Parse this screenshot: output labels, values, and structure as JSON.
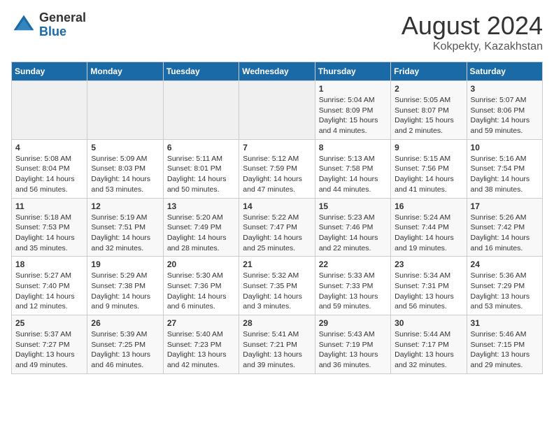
{
  "header": {
    "logo_general": "General",
    "logo_blue": "Blue",
    "title": "August 2024",
    "subtitle": "Kokpekty, Kazakhstan"
  },
  "calendar": {
    "days_of_week": [
      "Sunday",
      "Monday",
      "Tuesday",
      "Wednesday",
      "Thursday",
      "Friday",
      "Saturday"
    ],
    "weeks": [
      [
        {
          "day": "",
          "info": ""
        },
        {
          "day": "",
          "info": ""
        },
        {
          "day": "",
          "info": ""
        },
        {
          "day": "",
          "info": ""
        },
        {
          "day": "1",
          "info": "Sunrise: 5:04 AM\nSunset: 8:09 PM\nDaylight: 15 hours\nand 4 minutes."
        },
        {
          "day": "2",
          "info": "Sunrise: 5:05 AM\nSunset: 8:07 PM\nDaylight: 15 hours\nand 2 minutes."
        },
        {
          "day": "3",
          "info": "Sunrise: 5:07 AM\nSunset: 8:06 PM\nDaylight: 14 hours\nand 59 minutes."
        }
      ],
      [
        {
          "day": "4",
          "info": "Sunrise: 5:08 AM\nSunset: 8:04 PM\nDaylight: 14 hours\nand 56 minutes."
        },
        {
          "day": "5",
          "info": "Sunrise: 5:09 AM\nSunset: 8:03 PM\nDaylight: 14 hours\nand 53 minutes."
        },
        {
          "day": "6",
          "info": "Sunrise: 5:11 AM\nSunset: 8:01 PM\nDaylight: 14 hours\nand 50 minutes."
        },
        {
          "day": "7",
          "info": "Sunrise: 5:12 AM\nSunset: 7:59 PM\nDaylight: 14 hours\nand 47 minutes."
        },
        {
          "day": "8",
          "info": "Sunrise: 5:13 AM\nSunset: 7:58 PM\nDaylight: 14 hours\nand 44 minutes."
        },
        {
          "day": "9",
          "info": "Sunrise: 5:15 AM\nSunset: 7:56 PM\nDaylight: 14 hours\nand 41 minutes."
        },
        {
          "day": "10",
          "info": "Sunrise: 5:16 AM\nSunset: 7:54 PM\nDaylight: 14 hours\nand 38 minutes."
        }
      ],
      [
        {
          "day": "11",
          "info": "Sunrise: 5:18 AM\nSunset: 7:53 PM\nDaylight: 14 hours\nand 35 minutes."
        },
        {
          "day": "12",
          "info": "Sunrise: 5:19 AM\nSunset: 7:51 PM\nDaylight: 14 hours\nand 32 minutes."
        },
        {
          "day": "13",
          "info": "Sunrise: 5:20 AM\nSunset: 7:49 PM\nDaylight: 14 hours\nand 28 minutes."
        },
        {
          "day": "14",
          "info": "Sunrise: 5:22 AM\nSunset: 7:47 PM\nDaylight: 14 hours\nand 25 minutes."
        },
        {
          "day": "15",
          "info": "Sunrise: 5:23 AM\nSunset: 7:46 PM\nDaylight: 14 hours\nand 22 minutes."
        },
        {
          "day": "16",
          "info": "Sunrise: 5:24 AM\nSunset: 7:44 PM\nDaylight: 14 hours\nand 19 minutes."
        },
        {
          "day": "17",
          "info": "Sunrise: 5:26 AM\nSunset: 7:42 PM\nDaylight: 14 hours\nand 16 minutes."
        }
      ],
      [
        {
          "day": "18",
          "info": "Sunrise: 5:27 AM\nSunset: 7:40 PM\nDaylight: 14 hours\nand 12 minutes."
        },
        {
          "day": "19",
          "info": "Sunrise: 5:29 AM\nSunset: 7:38 PM\nDaylight: 14 hours\nand 9 minutes."
        },
        {
          "day": "20",
          "info": "Sunrise: 5:30 AM\nSunset: 7:36 PM\nDaylight: 14 hours\nand 6 minutes."
        },
        {
          "day": "21",
          "info": "Sunrise: 5:32 AM\nSunset: 7:35 PM\nDaylight: 14 hours\nand 3 minutes."
        },
        {
          "day": "22",
          "info": "Sunrise: 5:33 AM\nSunset: 7:33 PM\nDaylight: 13 hours\nand 59 minutes."
        },
        {
          "day": "23",
          "info": "Sunrise: 5:34 AM\nSunset: 7:31 PM\nDaylight: 13 hours\nand 56 minutes."
        },
        {
          "day": "24",
          "info": "Sunrise: 5:36 AM\nSunset: 7:29 PM\nDaylight: 13 hours\nand 53 minutes."
        }
      ],
      [
        {
          "day": "25",
          "info": "Sunrise: 5:37 AM\nSunset: 7:27 PM\nDaylight: 13 hours\nand 49 minutes."
        },
        {
          "day": "26",
          "info": "Sunrise: 5:39 AM\nSunset: 7:25 PM\nDaylight: 13 hours\nand 46 minutes."
        },
        {
          "day": "27",
          "info": "Sunrise: 5:40 AM\nSunset: 7:23 PM\nDaylight: 13 hours\nand 42 minutes."
        },
        {
          "day": "28",
          "info": "Sunrise: 5:41 AM\nSunset: 7:21 PM\nDaylight: 13 hours\nand 39 minutes."
        },
        {
          "day": "29",
          "info": "Sunrise: 5:43 AM\nSunset: 7:19 PM\nDaylight: 13 hours\nand 36 minutes."
        },
        {
          "day": "30",
          "info": "Sunrise: 5:44 AM\nSunset: 7:17 PM\nDaylight: 13 hours\nand 32 minutes."
        },
        {
          "day": "31",
          "info": "Sunrise: 5:46 AM\nSunset: 7:15 PM\nDaylight: 13 hours\nand 29 minutes."
        }
      ]
    ]
  }
}
